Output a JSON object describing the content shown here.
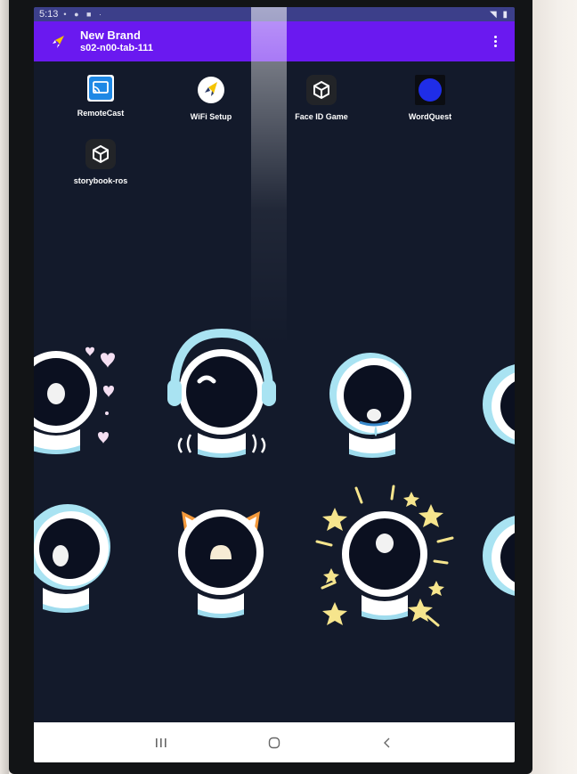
{
  "status_bar": {
    "time": "5:13",
    "left_icons": "• ● ■ ·",
    "right_icons": "◥ ▮"
  },
  "app_bar": {
    "title": "New Brand",
    "subtitle": "s02-n00-tab-111",
    "logo_icon": "rocket-icon",
    "menu_icon": "more-vert-icon"
  },
  "apps": [
    {
      "label": "RemoteCast",
      "icon": "cast-icon"
    },
    {
      "label": "WiFi Setup",
      "icon": "rocket-icon"
    },
    {
      "label": "Face ID Game",
      "icon": "unity-icon"
    },
    {
      "label": "WordQuest",
      "icon": "blue-circle-icon"
    },
    {
      "label": "storybook-ros",
      "icon": "unity-icon"
    }
  ],
  "robot_expressions": [
    "hearts",
    "headphones-dancing",
    "crying",
    "peek-right",
    "peek-left",
    "cat-ears",
    "stars",
    "peek-right"
  ],
  "nav_bar": {
    "recents_icon": "recents-icon",
    "home_icon": "home-icon",
    "back_icon": "back-icon"
  },
  "colors": {
    "app_bar": "#6a19f0",
    "screen_bg": "#131a2b",
    "robot_outline": "#ffffff",
    "robot_accent": "#a9e3f2",
    "star": "#f6e58d",
    "heart": "#f4dff2"
  }
}
